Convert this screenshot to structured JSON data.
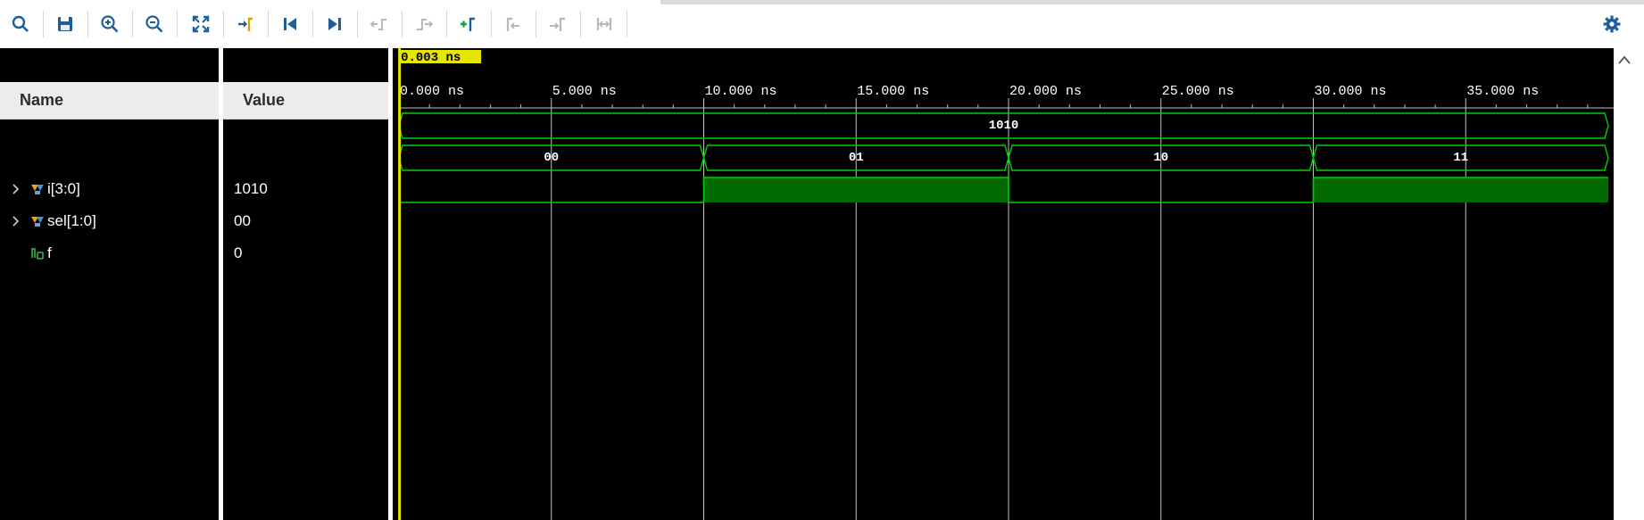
{
  "toolbar": {
    "buttons": [
      {
        "name": "search-icon",
        "enabled": true
      },
      {
        "name": "save-icon",
        "enabled": true
      },
      {
        "name": "zoom-in-icon",
        "enabled": true
      },
      {
        "name": "zoom-out-icon",
        "enabled": true
      },
      {
        "name": "zoom-fit-icon",
        "enabled": true
      },
      {
        "name": "go-to-cursor-icon",
        "enabled": true
      },
      {
        "name": "go-to-time-0-icon",
        "enabled": true
      },
      {
        "name": "go-to-last-time-icon",
        "enabled": true
      },
      {
        "name": "previous-transition-icon",
        "enabled": false
      },
      {
        "name": "next-transition-icon",
        "enabled": false
      },
      {
        "name": "add-marker-icon",
        "enabled": true
      },
      {
        "name": "previous-marker-icon",
        "enabled": false
      },
      {
        "name": "next-marker-icon",
        "enabled": false
      },
      {
        "name": "swap-cursors-icon",
        "enabled": false
      }
    ],
    "settings_icon": "gear-icon",
    "accent_color": "#1f5f99",
    "disabled_color": "#b8b8b8"
  },
  "columns": {
    "name_header": "Name",
    "value_header": "Value"
  },
  "signals": [
    {
      "name": "i[3:0]",
      "value": "1010",
      "kind": "bus",
      "expandable": true,
      "icon": "bus-signal-icon"
    },
    {
      "name": "sel[1:0]",
      "value": "00",
      "kind": "bus",
      "expandable": true,
      "icon": "bus-signal-icon"
    },
    {
      "name": "f",
      "value": "0",
      "kind": "bit",
      "expandable": false,
      "icon": "bit-signal-icon"
    }
  ],
  "waveform": {
    "cursor_label": "0.003 ns",
    "cursor_time_ns": 0.003,
    "time_unit": "ns",
    "visible_range_ns": [
      0,
      40
    ],
    "ticks": [
      "0.000 ns",
      "5.000 ns",
      "10.000 ns",
      "15.000 ns",
      "20.000 ns",
      "25.000 ns",
      "30.000 ns",
      "35.000 ns"
    ],
    "tick_times_ns": [
      0,
      5,
      10,
      15,
      20,
      25,
      30,
      35
    ],
    "wave_color": "#00d000",
    "fill_color": "#006a00",
    "cursor_color": "#e6e600",
    "traces": [
      {
        "signal": "i[3:0]",
        "type": "bus",
        "segments": [
          {
            "start": 0,
            "end": 40,
            "label": "1010"
          }
        ]
      },
      {
        "signal": "sel[1:0]",
        "type": "bus",
        "segments": [
          {
            "start": 0,
            "end": 10,
            "label": "00"
          },
          {
            "start": 10,
            "end": 20,
            "label": "01"
          },
          {
            "start": 20,
            "end": 30,
            "label": "10"
          },
          {
            "start": 30,
            "end": 40,
            "label": "11"
          }
        ]
      },
      {
        "signal": "f",
        "type": "bit",
        "levels": [
          {
            "start": 0,
            "end": 10,
            "value": 0
          },
          {
            "start": 10,
            "end": 20,
            "value": 1
          },
          {
            "start": 20,
            "end": 30,
            "value": 0
          },
          {
            "start": 30,
            "end": 40,
            "value": 1
          }
        ]
      }
    ]
  }
}
